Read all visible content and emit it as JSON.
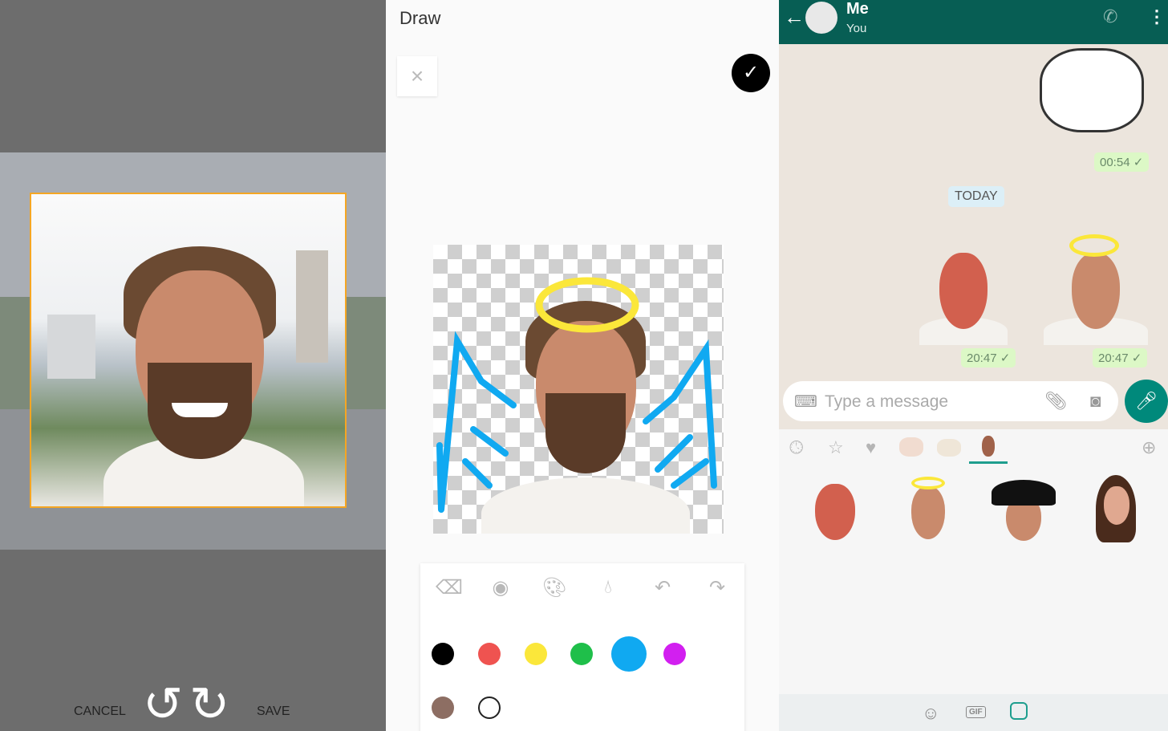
{
  "crop_screen": {
    "cancel_label": "CANCEL",
    "save_label": "SAVE",
    "accent": "#f5a623"
  },
  "draw_screen": {
    "title": "Draw",
    "tools": [
      "eraser-icon",
      "brush-size-icon",
      "palette-icon",
      "opacity-icon",
      "undo-icon",
      "redo-icon"
    ],
    "colors": [
      "#000000",
      "#ef5350",
      "#fbe73a",
      "#1fbf4a",
      "#10a9f1",
      "#d21ff0",
      "#8d6e63",
      "#ffffff"
    ],
    "selected_color": "#10a9f1"
  },
  "chat_screen": {
    "contact_name": "Me",
    "contact_status": "You",
    "header_color": "#075e54",
    "messages": [
      {
        "time": "00:54 ✓"
      },
      {
        "time": "20:47 ✓"
      },
      {
        "time": "20:47 ✓"
      }
    ],
    "date_divider": "TODAY",
    "input_placeholder": "Type a message",
    "bottom_tabs": {
      "gif": "GIF"
    }
  }
}
